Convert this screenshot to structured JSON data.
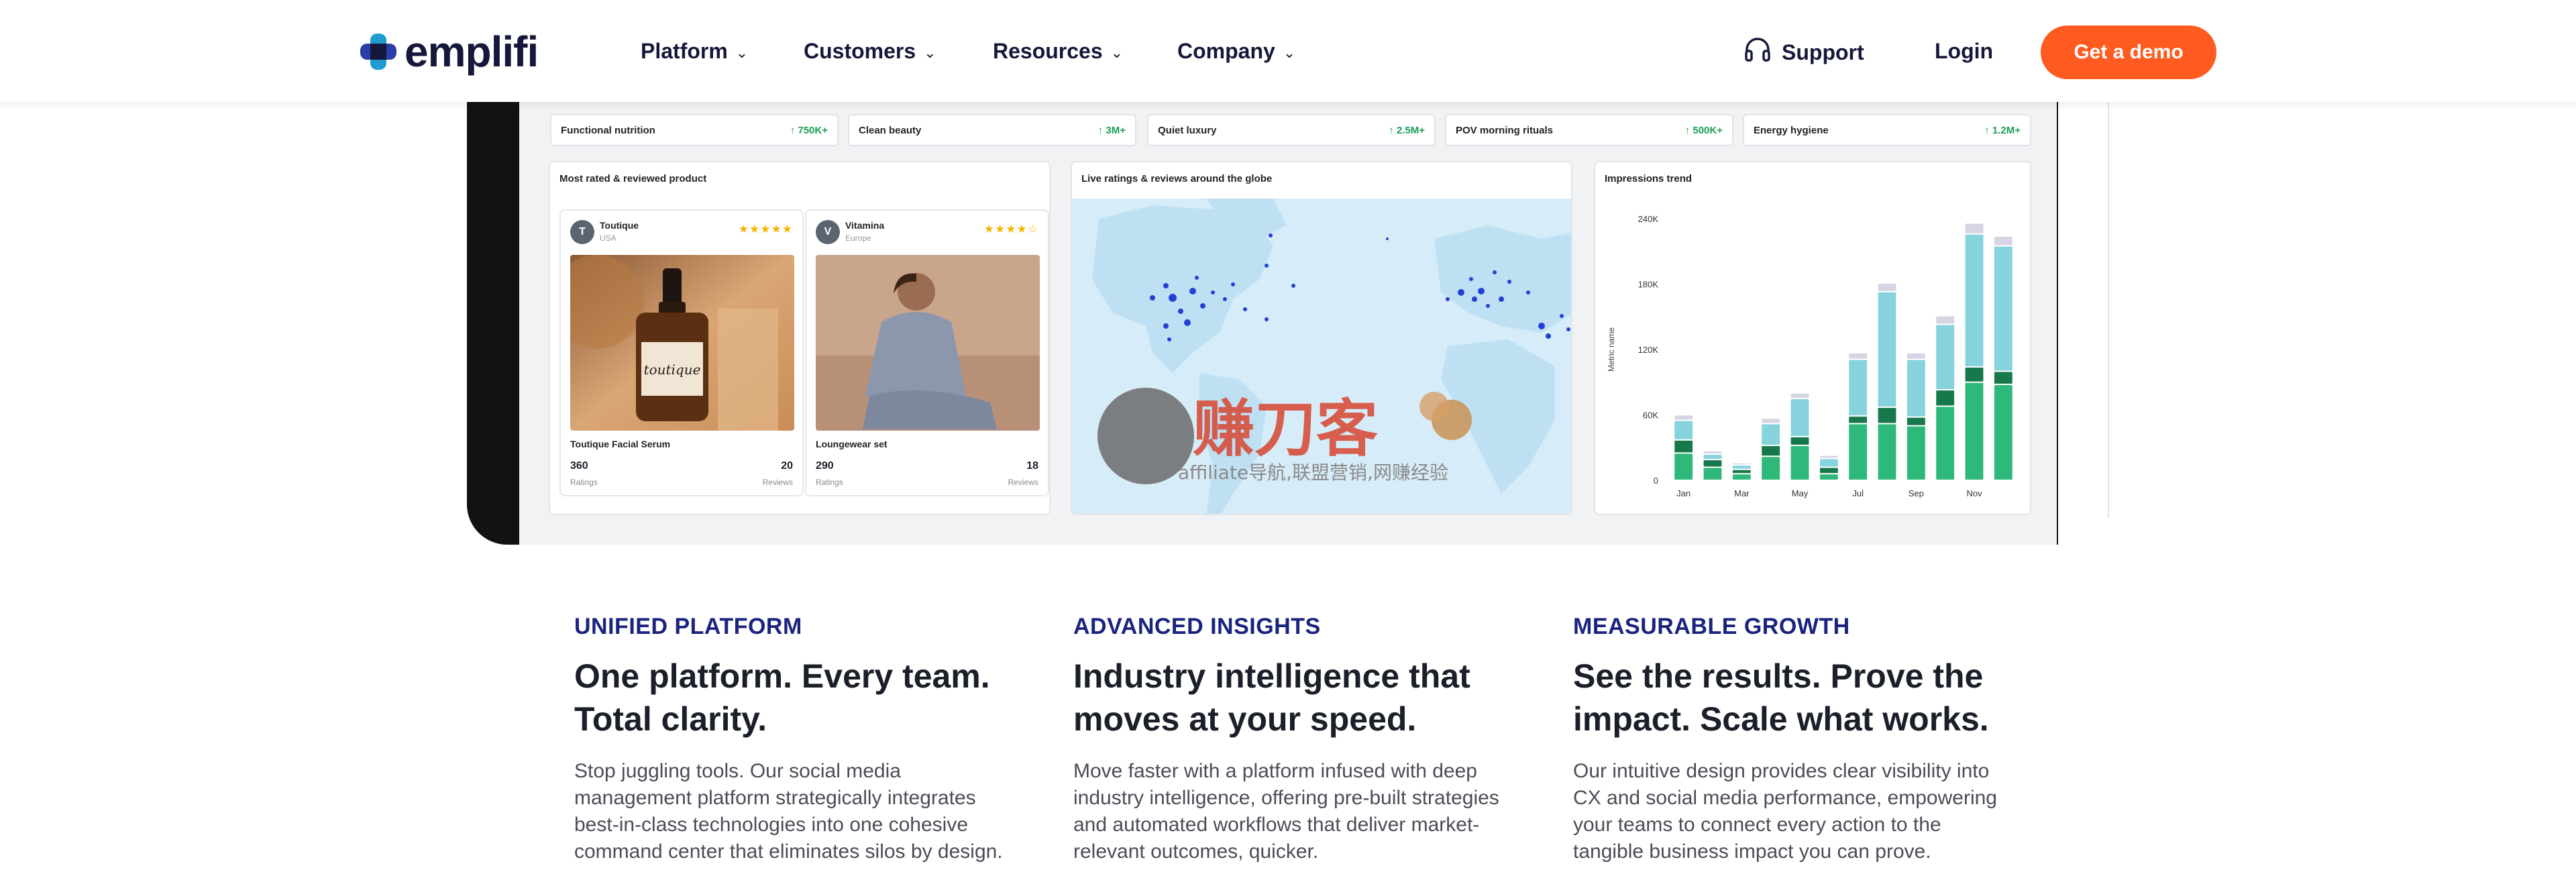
{
  "brand": {
    "name": "emplifi",
    "accent": "#ff5a1f",
    "navy": "#15183a"
  },
  "nav": {
    "items": [
      {
        "label": "Platform"
      },
      {
        "label": "Customers"
      },
      {
        "label": "Resources"
      },
      {
        "label": "Company"
      }
    ],
    "support_label": "Support",
    "login_label": "Login",
    "cta_label": "Get a demo"
  },
  "dashboard": {
    "trends": [
      {
        "label": "Functional nutrition",
        "delta": "↑ 750K+"
      },
      {
        "label": "Clean beauty",
        "delta": "↑ 3M+"
      },
      {
        "label": "Quiet luxury",
        "delta": "↑ 2.5M+"
      },
      {
        "label": "POV morning rituals",
        "delta": "↑ 500K+"
      },
      {
        "label": "Energy hygiene",
        "delta": "↑ 1.2M+"
      }
    ],
    "products_card": {
      "title": "Most rated & reviewed product",
      "products": [
        {
          "brand": "Toutique",
          "region": "USA",
          "stars": "★★★★★",
          "name": "Toutique Facial Serum",
          "ratings": "360",
          "ratings_label": "Ratings",
          "reviews": "20",
          "reviews_label": "Reviews",
          "avatar": "T",
          "label_text": "toutique"
        },
        {
          "brand": "Vitamina",
          "region": "Europe",
          "stars": "★★★★☆",
          "name": "Loungewear set",
          "ratings": "290",
          "ratings_label": "Ratings",
          "reviews": "18",
          "reviews_label": "Reviews",
          "avatar": "V"
        }
      ]
    },
    "map_card": {
      "title": "Live ratings & reviews around the globe",
      "watermark_text": "赚刀客",
      "watermark_sub": "affiliate导航,联盟营销,网赚经验"
    },
    "impressions_card": {
      "title": "Impressions trend"
    }
  },
  "chart_data": {
    "type": "bar",
    "stacked": true,
    "title": "Impressions trend",
    "xlabel": "",
    "ylabel": "Metric name",
    "ylim": [
      0,
      240000
    ],
    "yticks": [
      "0",
      "60K",
      "120K",
      "180K",
      "240K"
    ],
    "categories": [
      "Jan",
      "",
      "Mar",
      "",
      "May",
      "",
      "Jul",
      "",
      "Sep",
      "",
      "Nov",
      ""
    ],
    "series": [
      {
        "color": "#2eb87a",
        "values": [
          25000,
          12000,
          6000,
          22000,
          32000,
          6000,
          52000,
          52000,
          50000,
          68000,
          90000,
          88000
        ]
      },
      {
        "color": "#17784b",
        "values": [
          12000,
          7000,
          4000,
          10000,
          8000,
          6000,
          7000,
          15000,
          8000,
          15000,
          14000,
          12000
        ]
      },
      {
        "color": "#86d3de",
        "values": [
          18000,
          5000,
          4000,
          20000,
          35000,
          8000,
          52000,
          106000,
          53000,
          60000,
          122000,
          115000
        ]
      },
      {
        "color": "#d7d4e3",
        "values": [
          5000,
          3000,
          2000,
          5000,
          5000,
          3000,
          6000,
          8000,
          6000,
          8000,
          10000,
          9000
        ]
      }
    ],
    "grid": false,
    "legend": "none"
  },
  "features": [
    {
      "eyebrow": "UNIFIED PLATFORM",
      "headline": "One platform. Every team. Total clarity.",
      "body": "Stop juggling tools. Our social media management platform strategically integrates best-in-class technologies into one cohesive command center that eliminates silos by design."
    },
    {
      "eyebrow": "ADVANCED INSIGHTS",
      "headline": "Industry intelligence that moves at your speed.",
      "body": "Move faster with a platform infused with deep industry intelligence, offering pre-built strategies and automated workflows that deliver market-relevant outcomes, quicker."
    },
    {
      "eyebrow": "MEASURABLE GROWTH",
      "headline": "See the results. Prove the impact. Scale what works.",
      "body": "Our intuitive design provides clear visibility into CX and social media performance, empowering your teams to connect every action to the tangible business impact you can prove."
    }
  ]
}
